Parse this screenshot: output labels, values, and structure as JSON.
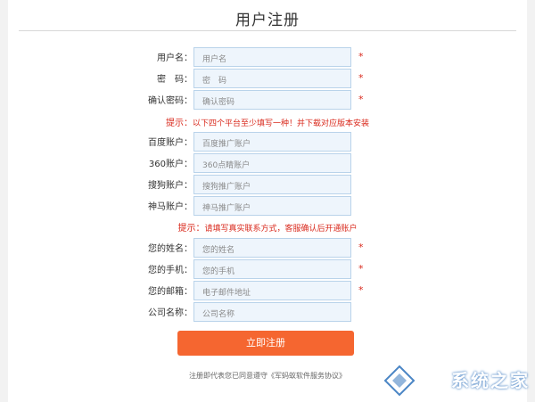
{
  "page": {
    "title": "用户注册"
  },
  "form": {
    "fields": [
      {
        "label": "用户名：",
        "placeholder": "用户名",
        "required": true
      },
      {
        "label": "密　码：",
        "placeholder": "密　码",
        "required": true
      },
      {
        "label": "确认密码：",
        "placeholder": "确认密码",
        "required": true
      },
      {
        "label": "百度账户：",
        "placeholder": "百度推广账户",
        "required": false
      },
      {
        "label": "360账户：",
        "placeholder": "360点睛账户",
        "required": false
      },
      {
        "label": "搜狗账户：",
        "placeholder": "搜狗推广账户",
        "required": false
      },
      {
        "label": "神马账户：",
        "placeholder": "神马推广账户",
        "required": false
      },
      {
        "label": "您的姓名：",
        "placeholder": "您的姓名",
        "required": true
      },
      {
        "label": "您的手机：",
        "placeholder": "您的手机",
        "required": true
      },
      {
        "label": "您的邮箱：",
        "placeholder": "电子邮件地址",
        "required": true
      },
      {
        "label": "公司名称：",
        "placeholder": "公司名称",
        "required": false
      }
    ],
    "required_mark": "*",
    "tips": [
      {
        "head": "提示：",
        "text": "以下四个平台至少填写一种！并下载对应版本安装"
      },
      {
        "head": "提示：",
        "text": "请填写真实联系方式，客服确认后开通账户"
      }
    ],
    "submit_label": "立即注册",
    "agreement_prefix": "注册即代表您已同意遵守",
    "agreement_link": "《军蚂蚁软件服务协议》"
  },
  "watermark": {
    "text": "系统之家"
  },
  "colors": {
    "accent": "#f56630",
    "tip": "#d9291c",
    "field_bg": "#eef5fc",
    "field_border": "#b9d3ea"
  }
}
